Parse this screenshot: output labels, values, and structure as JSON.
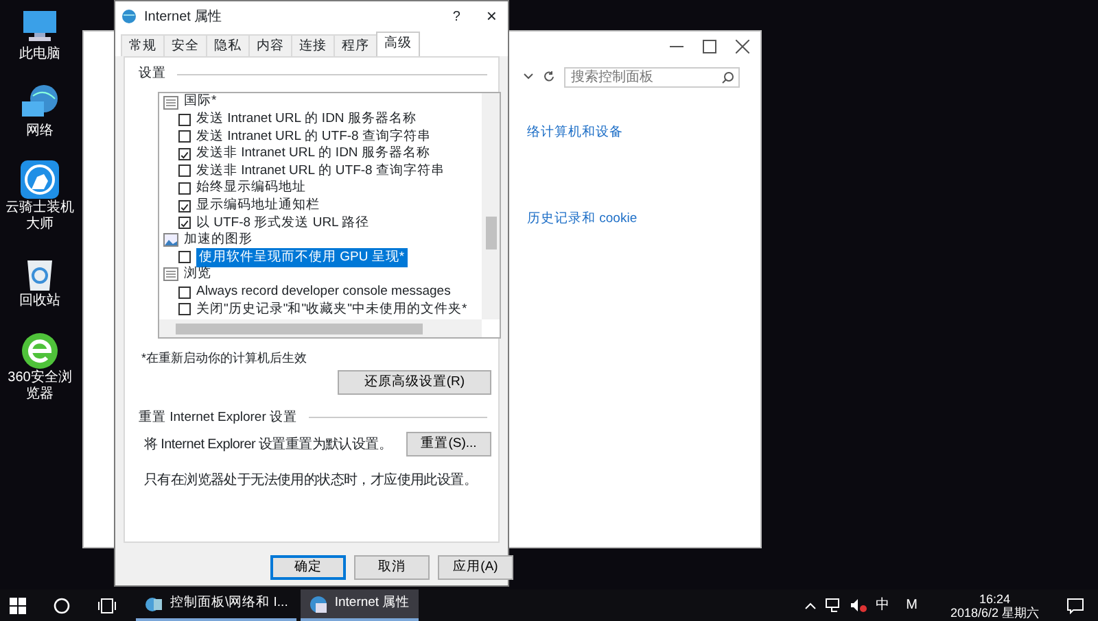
{
  "desktop_icons": [
    {
      "label": "此电脑",
      "kind": "pc"
    },
    {
      "label": "网络",
      "kind": "network"
    },
    {
      "label": "云骑士装机大师",
      "kind": "knight"
    },
    {
      "label": "回收站",
      "kind": "bin"
    },
    {
      "label": "360安全浏览器",
      "kind": "browser"
    }
  ],
  "background_window": {
    "search": {
      "placeholder": "搜索控制面板"
    },
    "links": [
      "络计算机和设备",
      "历史记录和 cookie"
    ]
  },
  "dialog": {
    "title": "Internet 属性",
    "help": "?",
    "close": "×",
    "tabs": [
      {
        "label": "常规",
        "selected": false
      },
      {
        "label": "安全",
        "selected": false
      },
      {
        "label": "隐私",
        "selected": false
      },
      {
        "label": "内容",
        "selected": false
      },
      {
        "label": "连接",
        "selected": false
      },
      {
        "label": "程序",
        "selected": false
      },
      {
        "label": "高级",
        "selected": true
      }
    ],
    "settings_label": "设置",
    "tree": [
      {
        "label": "国际*",
        "kind": "list",
        "children": [
          {
            "label": "发送 Intranet URL 的 IDN 服务器名称",
            "checked": false,
            "selected": false
          },
          {
            "label": "发送 Intranet URL 的 UTF-8 查询字符串",
            "checked": false,
            "selected": false
          },
          {
            "label": "发送非 Intranet URL 的 IDN 服务器名称",
            "checked": true,
            "selected": false
          },
          {
            "label": "发送非 Intranet URL 的 UTF-8 查询字符串",
            "checked": false,
            "selected": false
          },
          {
            "label": "始终显示编码地址",
            "checked": false,
            "selected": false
          },
          {
            "label": "显示编码地址通知栏",
            "checked": true,
            "selected": false
          },
          {
            "label": "以 UTF-8 形式发送 URL 路径",
            "checked": true,
            "selected": false
          }
        ]
      },
      {
        "label": "加速的图形",
        "kind": "image",
        "children": [
          {
            "label": "使用软件呈现而不使用 GPU 呈现*",
            "checked": false,
            "selected": true
          }
        ]
      },
      {
        "label": "浏览",
        "kind": "list",
        "children": [
          {
            "label": "Always record developer console messages",
            "checked": false,
            "selected": false
          },
          {
            "label": "关闭\"历史记录\"和\"收藏夹\"中未使用的文件夹*",
            "checked": false,
            "selected": false
          }
        ]
      }
    ],
    "restart_note": "*在重新启动你的计算机后生效",
    "restore_button": "还原高级设置(R)",
    "reset_group": {
      "title": "重置 Internet Explorer 设置",
      "description": "将 Internet Explorer 设置重置为默认设置。",
      "button": "重置(S)...",
      "note": "只有在浏览器处于无法使用的状态时，才应使用此设置。"
    },
    "buttons": [
      {
        "label": "确定",
        "default": true
      },
      {
        "label": "取消",
        "default": false
      },
      {
        "label": "应用(A)",
        "default": false
      }
    ]
  },
  "taskbar": {
    "apps": [
      {
        "label": "控制面板\\网络和 I...",
        "kind": "control",
        "selected": false
      },
      {
        "label": "Internet 属性",
        "kind": "ie",
        "selected": true
      }
    ],
    "ime": "中",
    "ime_mode": "M",
    "time": "16:24",
    "date": "2018/6/2 星期六"
  }
}
